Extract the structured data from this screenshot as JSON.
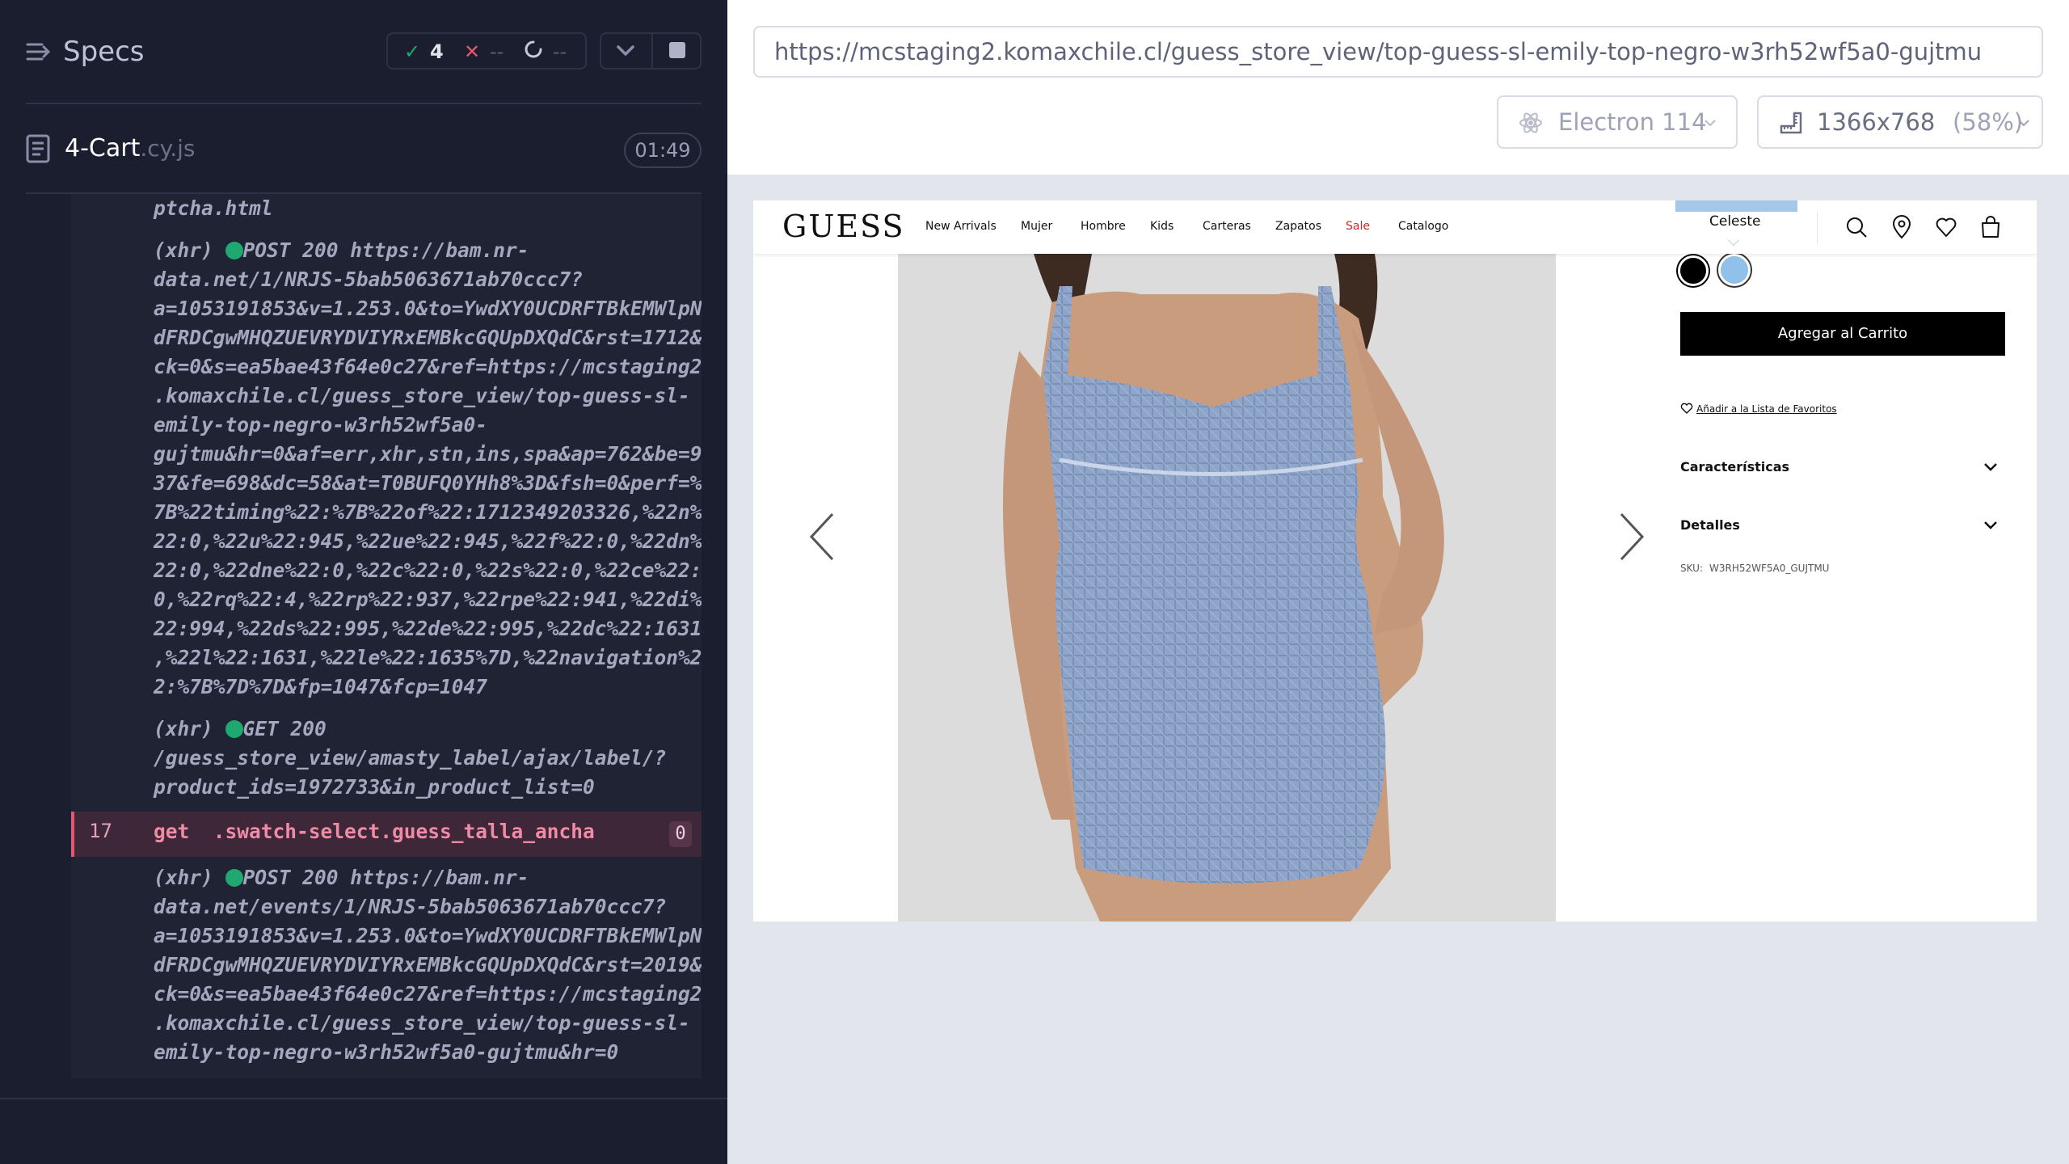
{
  "reporter": {
    "specs_label": "Specs",
    "stats": {
      "passed": "4",
      "failed": "--",
      "pending": "--"
    },
    "spec": {
      "name": "4-Cart",
      "ext": ".cy.js",
      "duration": "01:49"
    },
    "log": {
      "tail": "ptcha.html",
      "post1": {
        "kind": "(xhr)",
        "request": "POST 200 https://bam.nr-",
        "body": "data.net/1/NRJS-5bab5063671ab70ccc7?\na=1053191853&v=1.253.0&to=YwdXY0UCDRFTBkEMWlpN\ndFRDCgwMHQZUEVRYDVIYRxEMBkcGQUpDXQdC&rst=1712&\nck=0&s=ea5bae43f64e0c27&ref=https://mcstaging2\n.komaxchile.cl/guess_store_view/top-guess-sl-\nemily-top-negro-w3rh52wf5a0-\ngujtmu&hr=0&af=err,xhr,stn,ins,spa&ap=762&be=9\n37&fe=698&dc=58&at=T0BUFQ0YHh8%3D&fsh=0&perf=%\n7B%22timing%22:%7B%22of%22:1712349203326,%22n%\n22:0,%22u%22:945,%22ue%22:945,%22f%22:0,%22dn%\n22:0,%22dne%22:0,%22c%22:0,%22s%22:0,%22ce%22:\n0,%22rq%22:4,%22rp%22:937,%22rpe%22:941,%22di%\n22:994,%22ds%22:995,%22de%22:995,%22dc%22:1631\n,%22l%22:1631,%22le%22:1635%7D,%22navigation%2\n2:%7B%7D%7D&fp=1047&fcp=1047"
      },
      "get1": {
        "kind": "(xhr)",
        "request": "GET 200",
        "body": "/guess_store_view/amasty_label/ajax/label/?\nproduct_ids=1972733&in_product_list=0"
      },
      "get_cmd": {
        "number": "17",
        "name": "get",
        "selector": ".swatch-select.guess_talla_ancha",
        "count": "0"
      },
      "post2": {
        "kind": "(xhr)",
        "request": "POST 200 https://bam.nr-",
        "body": "data.net/events/1/NRJS-5bab5063671ab70ccc7?\na=1053191853&v=1.253.0&to=YwdXY0UCDRFTBkEMWlpN\ndFRDCgwMHQZUEVRYDVIYRxEMBkcGQUpDXQdC&rst=2019&\nck=0&s=ea5bae43f64e0c27&ref=https://mcstaging2\n.komaxchile.cl/guess_store_view/top-guess-sl-\nemily-top-negro-w3rh52wf5a0-gujtmu&hr=0"
      }
    }
  },
  "aut": {
    "url": "https://mcstaging2.komaxchile.cl/guess_store_view/top-guess-sl-emily-top-negro-w3rh52wf5a0-gujtmu",
    "browser": "Electron 114",
    "viewport": "1366x768",
    "scale": "(58%)"
  },
  "site": {
    "logo": "GUESS",
    "nav": [
      "New Arrivals",
      "Mujer",
      "Hombre",
      "Kids",
      "Carteras",
      "Zapatos",
      "Sale",
      "Catalogo"
    ],
    "tooltip": "Celeste",
    "add_to_cart": "Agregar al Carrito",
    "wishlist": "Añadir a la Lista de Favoritos",
    "accordion": [
      "Características",
      "Detalles"
    ],
    "sku_label": "SKU:",
    "sku_value": "W3RH52WF5A0_GUJTMU"
  },
  "colors": {
    "reporter_bg": "#1b1e2e",
    "pass": "#1fa971",
    "fail": "#e45770",
    "sale": "#d8232a",
    "swatch_celeste": "#8fc1ea"
  }
}
